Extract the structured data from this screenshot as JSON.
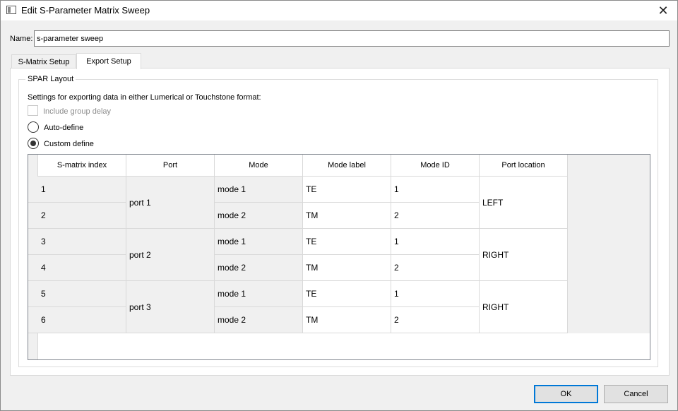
{
  "window": {
    "title": "Edit S-Parameter Matrix Sweep",
    "close_glyph": "✕"
  },
  "name": {
    "label": "Name:",
    "value": "s-parameter sweep"
  },
  "tabs": [
    {
      "label": "S-Matrix Setup",
      "active": false
    },
    {
      "label": "Export Setup",
      "active": true
    }
  ],
  "spar": {
    "group_title": "SPAR Layout",
    "description": "Settings for exporting data in either Lumerical or Touchstone format:",
    "include_group_delay": {
      "label": "Include group delay",
      "checked": false,
      "enabled": false
    },
    "auto_define": {
      "label": "Auto-define",
      "selected": false
    },
    "custom_define": {
      "label": "Custom define",
      "selected": true
    }
  },
  "table": {
    "headers": [
      "S-matrix index",
      "Port",
      "Mode",
      "Mode label",
      "Mode ID",
      "Port location"
    ],
    "rows": [
      {
        "index": "1",
        "mode": "mode 1",
        "mode_label": "TE",
        "mode_id": "1"
      },
      {
        "index": "2",
        "mode": "mode 2",
        "mode_label": "TM",
        "mode_id": "2"
      },
      {
        "index": "3",
        "mode": "mode 1",
        "mode_label": "TE",
        "mode_id": "1"
      },
      {
        "index": "4",
        "mode": "mode 2",
        "mode_label": "TM",
        "mode_id": "2"
      },
      {
        "index": "5",
        "mode": "mode 1",
        "mode_label": "TE",
        "mode_id": "1"
      },
      {
        "index": "6",
        "mode": "mode 2",
        "mode_label": "TM",
        "mode_id": "2"
      }
    ],
    "ports": [
      {
        "name": "port 1",
        "location": "LEFT"
      },
      {
        "name": "port 2",
        "location": "RIGHT"
      },
      {
        "name": "port 3",
        "location": "RIGHT"
      }
    ]
  },
  "buttons": {
    "ok": "OK",
    "cancel": "Cancel"
  },
  "colors": {
    "accent": "#0078d7",
    "window_bg": "#f0f0f0",
    "grid_line": "#d9d9d9",
    "readonly_cell": "#f0f0f0"
  }
}
